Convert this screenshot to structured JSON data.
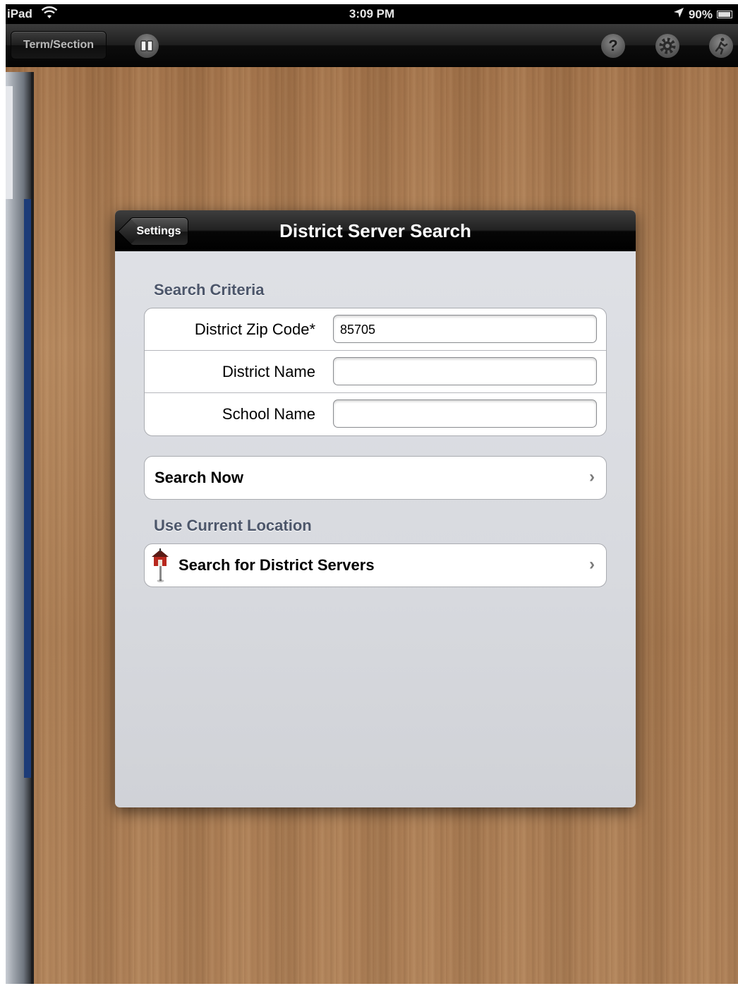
{
  "status_bar": {
    "carrier": "iPad",
    "time": "3:09 PM",
    "battery": "90%"
  },
  "toolbar": {
    "term_section_label": "Term/Section",
    "icons": [
      "book-icon",
      "help-icon",
      "gear-icon",
      "runner-icon"
    ],
    "help_glyph": "?"
  },
  "popover": {
    "back_label": "Settings",
    "title": "District Server Search",
    "search_criteria": {
      "section_title": "Search Criteria",
      "fields": [
        {
          "label": "District Zip Code*",
          "value": "85705"
        },
        {
          "label": "District Name",
          "value": ""
        },
        {
          "label": "School Name",
          "value": ""
        }
      ],
      "search_button": "Search Now"
    },
    "current_location": {
      "section_title": "Use Current Location",
      "button": "Search for District Servers",
      "icon": "schoolhouse-pin-icon"
    },
    "chevron": "›"
  }
}
